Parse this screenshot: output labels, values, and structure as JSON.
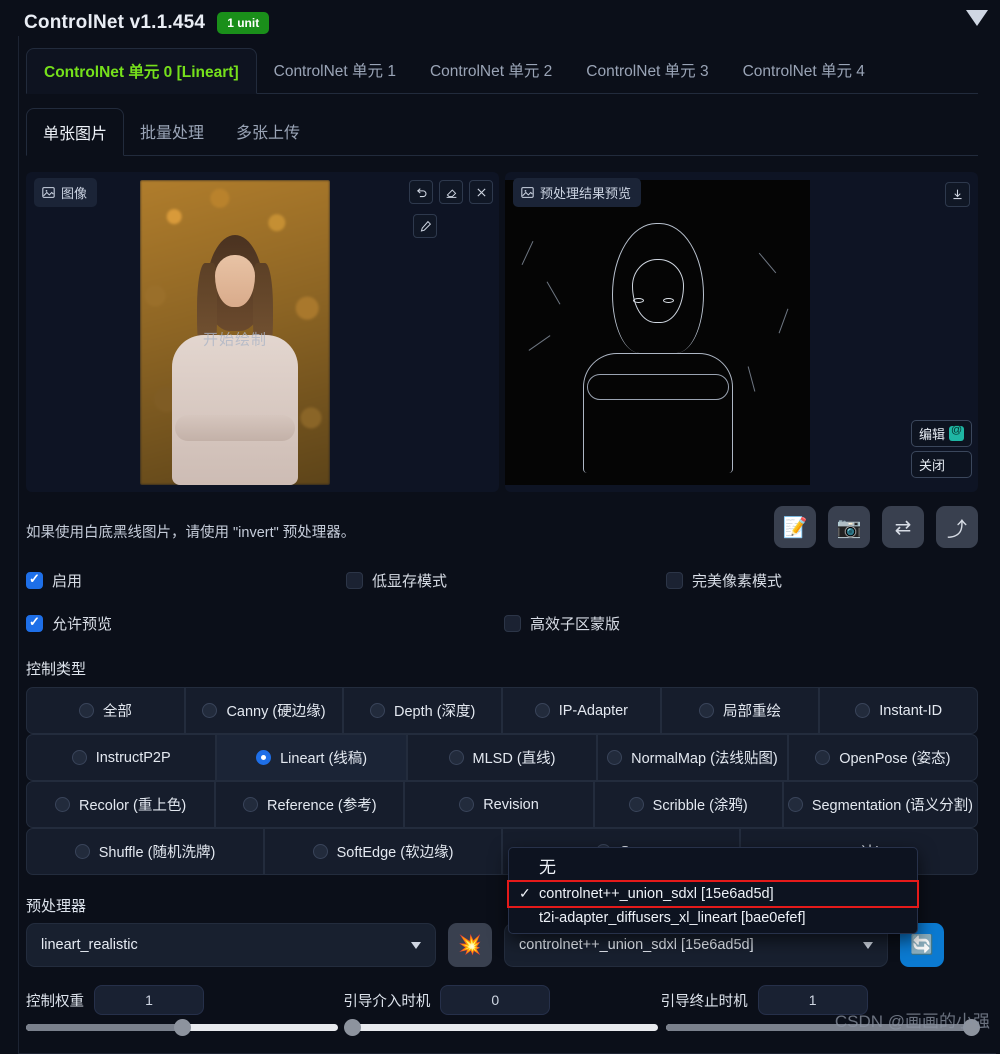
{
  "header": {
    "title": "ControlNet v1.1.454",
    "badge": "1 unit",
    "collapse_icon": "triangle-down-icon"
  },
  "unit_tabs": [
    {
      "label": "ControlNet 单元 0 [Lineart]",
      "active": true
    },
    {
      "label": "ControlNet 单元 1",
      "active": false
    },
    {
      "label": "ControlNet 单元 2",
      "active": false
    },
    {
      "label": "ControlNet 单元 3",
      "active": false
    },
    {
      "label": "ControlNet 单元 4",
      "active": false
    }
  ],
  "sub_tabs": [
    {
      "label": "单张图片",
      "active": true
    },
    {
      "label": "批量处理",
      "active": false
    },
    {
      "label": "多张上传",
      "active": false
    }
  ],
  "image_panel": {
    "input_label": "图像",
    "draw_hint": "开始绘制",
    "preview_label": "预处理结果预览",
    "tools": [
      "undo-icon",
      "eraser-icon",
      "close-icon",
      "pen-icon"
    ],
    "download_icon": "download-icon",
    "edit_button": "编辑",
    "close_button": "关闭"
  },
  "hint": "如果使用白底黑线图片，请使用 \"invert\" 预处理器。",
  "action_buttons": [
    {
      "name": "note-edit-button",
      "glyph": "📝"
    },
    {
      "name": "camera-button",
      "glyph": "📷"
    },
    {
      "name": "swap-button",
      "glyph": "⇄"
    },
    {
      "name": "upload-button",
      "glyph": "⤴"
    }
  ],
  "checkboxes": [
    {
      "label": "启用",
      "checked": true
    },
    {
      "label": "低显存模式",
      "checked": false
    },
    {
      "label": "完美像素模式",
      "checked": false
    },
    {
      "label": "允许预览",
      "checked": true
    },
    {
      "label": "高效子区蒙版",
      "checked": false
    }
  ],
  "control_type": {
    "label": "控制类型",
    "rows": [
      [
        {
          "label": "全部",
          "selected": false
        },
        {
          "label": "Canny (硬边缘)",
          "selected": false
        },
        {
          "label": "Depth (深度)",
          "selected": false
        },
        {
          "label": "IP-Adapter",
          "selected": false
        },
        {
          "label": "局部重绘",
          "selected": false
        },
        {
          "label": "Instant-ID",
          "selected": false
        }
      ],
      [
        {
          "label": "InstructP2P",
          "selected": false
        },
        {
          "label": "Lineart (线稿)",
          "selected": true
        },
        {
          "label": "MLSD (直线)",
          "selected": false
        },
        {
          "label": "NormalMap (法线贴图)",
          "selected": false
        },
        {
          "label": "OpenPose (姿态)",
          "selected": false
        }
      ],
      [
        {
          "label": "Recolor (重上色)",
          "selected": false
        },
        {
          "label": "Reference (参考)",
          "selected": false
        },
        {
          "label": "Revision",
          "selected": false
        },
        {
          "label": "Scribble (涂鸦)",
          "selected": false
        },
        {
          "label": "Segmentation (语义分割)",
          "selected": false
        }
      ],
      [
        {
          "label": "Shuffle (随机洗牌)",
          "selected": false
        },
        {
          "label": "SoftEdge (软边缘)",
          "selected": false
        },
        {
          "label": "Spa",
          "selected": false
        },
        {
          "label": "决)",
          "selected": false
        }
      ]
    ]
  },
  "dropdown": {
    "items": [
      {
        "label": "无",
        "checked": false
      },
      {
        "label": "controlnet++_union_sdxl [15e6ad5d]",
        "checked": true
      },
      {
        "label": "t2i-adapter_diffusers_xl_lineart [bae0efef]",
        "checked": false
      }
    ],
    "highlight_color": "#e51a1a"
  },
  "preprocessor": {
    "label": "预处理器",
    "value": "lineart_realistic",
    "explode_icon": "💥",
    "model_value": "controlnet++_union_sdxl [15e6ad5d]",
    "refresh_icon": "🔄"
  },
  "sliders": [
    {
      "label": "控制权重",
      "value": "1",
      "fill_pct": 50
    },
    {
      "label": "引导介入时机",
      "value": "0",
      "fill_pct": 0
    },
    {
      "label": "引导终止时机",
      "value": "1",
      "fill_pct": 100
    }
  ],
  "watermark": "CSDN @画画的小强"
}
